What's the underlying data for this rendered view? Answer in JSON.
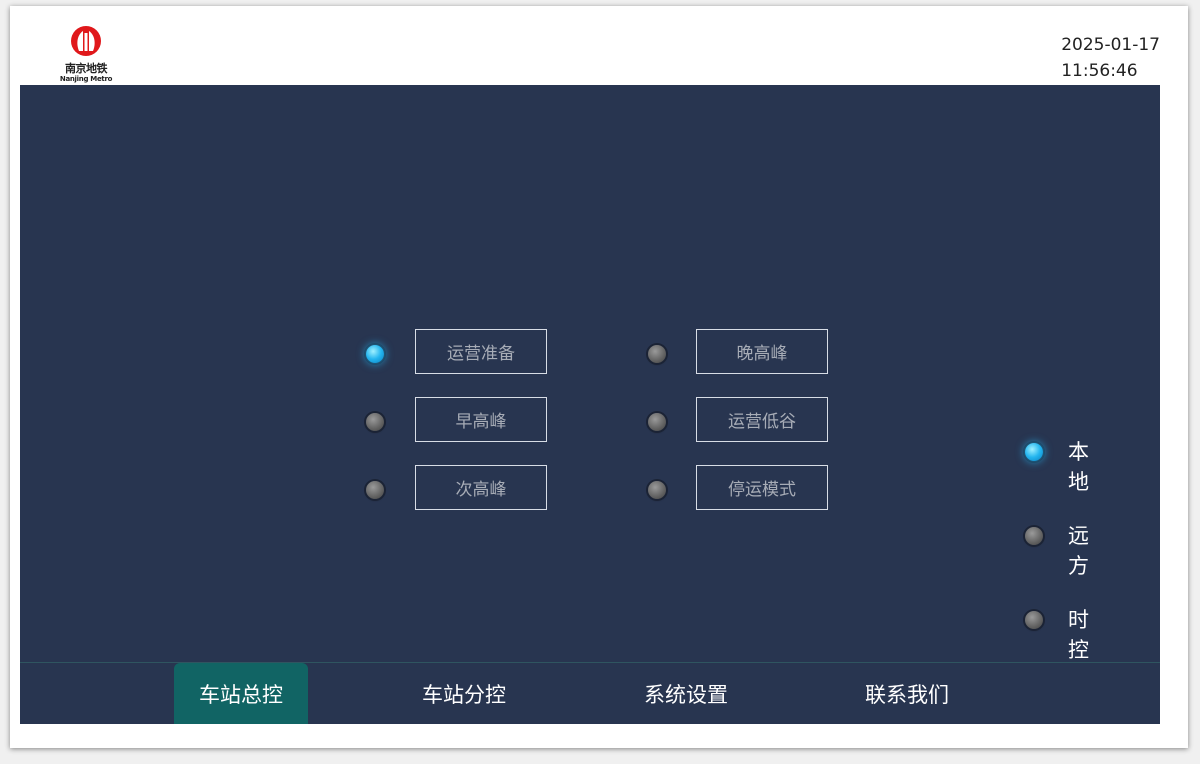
{
  "header": {
    "logo": {
      "cn": "南京地铁",
      "en": "Nanjing Metro",
      "color": "#e0181b"
    },
    "date": "2025-01-17",
    "time": "11:56:46"
  },
  "modes": [
    {
      "label": "运营准备",
      "active": true
    },
    {
      "label": "早高峰",
      "active": false
    },
    {
      "label": "次高峰",
      "active": false
    },
    {
      "label": "晚高峰",
      "active": false
    },
    {
      "label": "运营低谷",
      "active": false
    },
    {
      "label": "停运模式",
      "active": false
    }
  ],
  "control_source": [
    {
      "label": "本地",
      "active": true
    },
    {
      "label": "远方",
      "active": false
    },
    {
      "label": "时控",
      "active": false
    }
  ],
  "nav": {
    "tabs": [
      {
        "label": "车站总控",
        "active": true
      },
      {
        "label": "车站分控",
        "active": false
      },
      {
        "label": "系统设置",
        "active": false
      },
      {
        "label": "联系我们",
        "active": false
      }
    ]
  },
  "colors": {
    "panel_bg": "#283550",
    "active_tab": "#116464",
    "led_on": "#23b5ef",
    "led_off": "#666666"
  }
}
